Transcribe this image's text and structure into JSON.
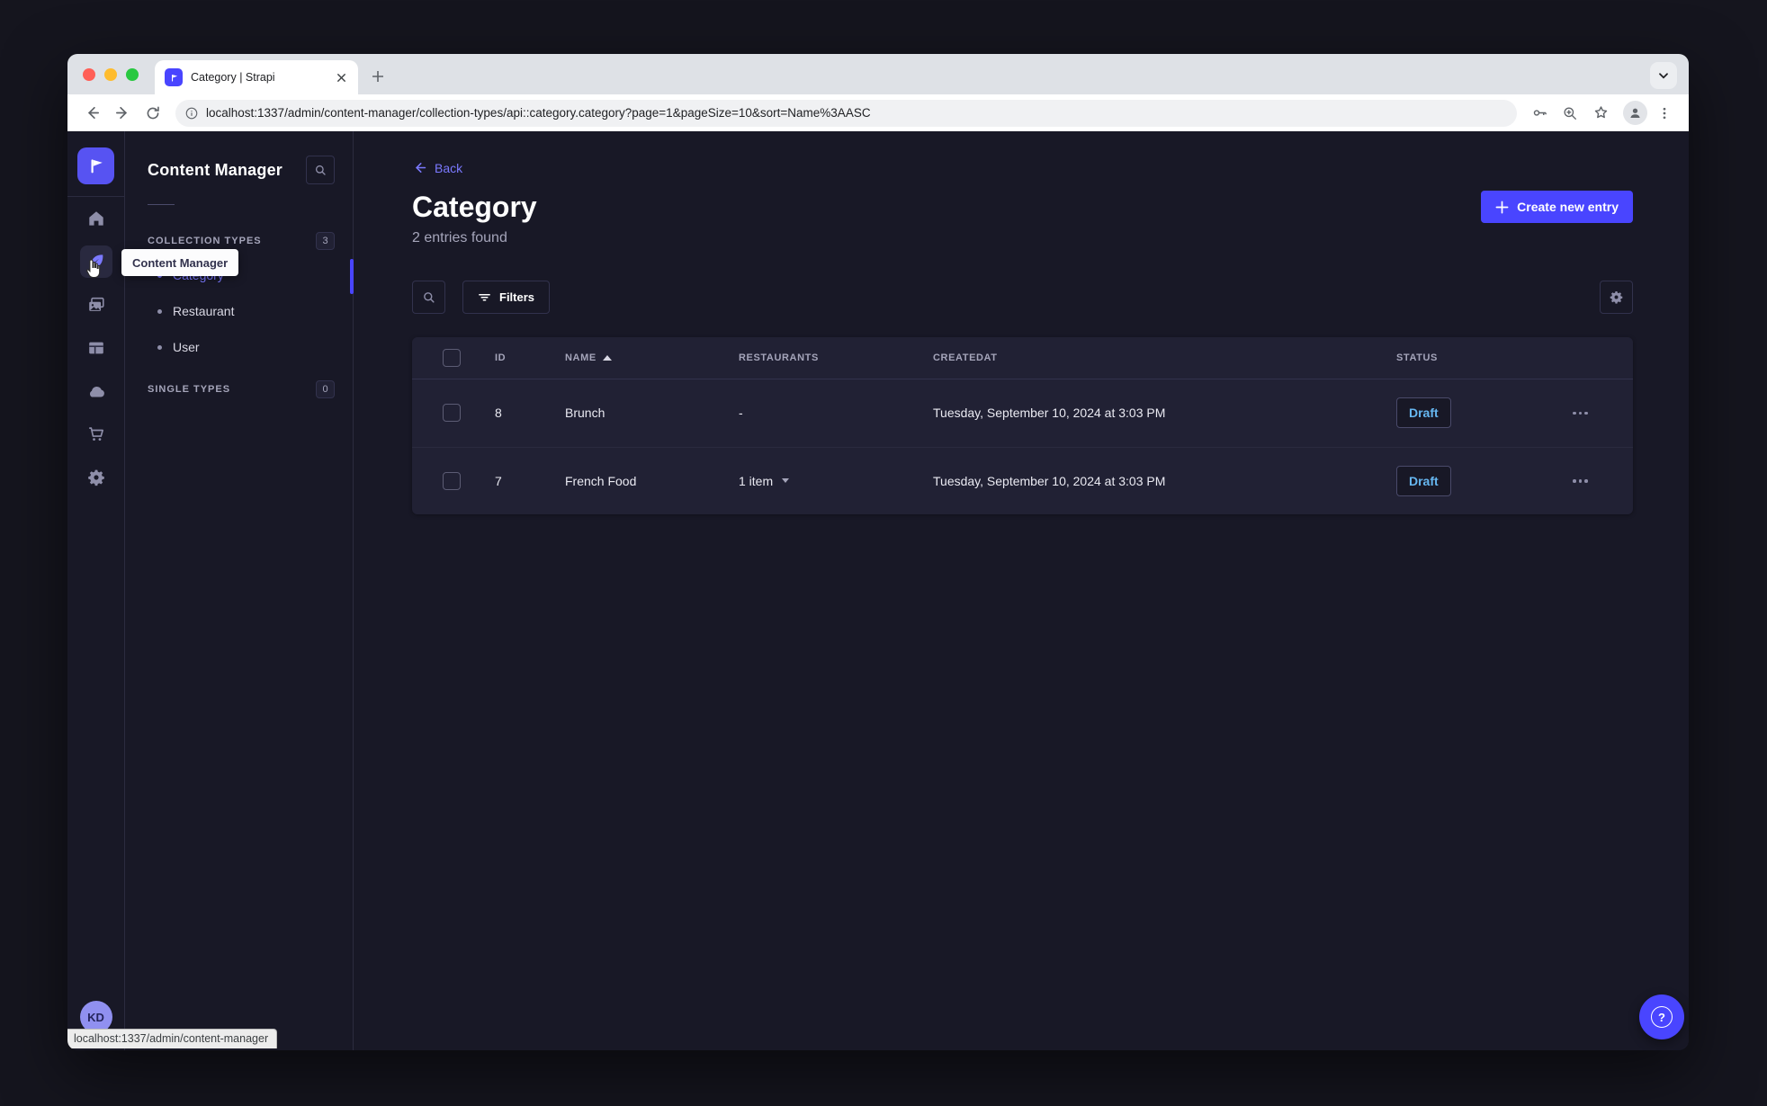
{
  "browser": {
    "tab_title": "Category | Strapi",
    "url": "localhost:1337/admin/content-manager/collection-types/api::category.category?page=1&pageSize=10&sort=Name%3AASC",
    "traffic_lights": {
      "close": "#ff5f57",
      "minimize": "#febc2e",
      "zoom": "#28c840"
    }
  },
  "rail": {
    "items": [
      {
        "id": "home"
      },
      {
        "id": "content-manager",
        "active": true
      },
      {
        "id": "media-library"
      },
      {
        "id": "content-type-builder"
      },
      {
        "id": "cloud"
      },
      {
        "id": "marketplace"
      },
      {
        "id": "settings"
      }
    ],
    "avatar_initials": "KD"
  },
  "sidebar": {
    "title": "Content Manager",
    "collection_types": {
      "label": "COLLECTION TYPES",
      "count": "3",
      "items": [
        {
          "label": "Category",
          "active": true
        },
        {
          "label": "Restaurant"
        },
        {
          "label": "User"
        }
      ]
    },
    "single_types": {
      "label": "SINGLE TYPES",
      "count": "0"
    }
  },
  "tooltip": {
    "text": "Content Manager"
  },
  "status_bar": {
    "text": "localhost:1337/admin/content-manager"
  },
  "main": {
    "back_label": "Back",
    "title": "Category",
    "subtitle": "2 entries found",
    "create_button_label": "Create new entry",
    "filters_button_label": "Filters"
  },
  "table": {
    "headers": [
      "ID",
      "NAME",
      "RESTAURANTS",
      "CREATEDAT",
      "STATUS"
    ],
    "sorted_by": "NAME",
    "sort_direction": "ASC",
    "rows": [
      {
        "id": "8",
        "name": "Brunch",
        "restaurants": "-",
        "created_at": "Tuesday, September 10, 2024 at 3:03 PM",
        "status": "Draft"
      },
      {
        "id": "7",
        "name": "French Food",
        "restaurants": "1 item",
        "created_at": "Tuesday, September 10, 2024 at 3:03 PM",
        "status": "Draft"
      }
    ]
  },
  "colors": {
    "accent": "#4945ff",
    "accent_light": "#7b79ff",
    "draft_text": "#66b7f1",
    "page_bg": "#181826",
    "surface_bg": "#212134"
  }
}
